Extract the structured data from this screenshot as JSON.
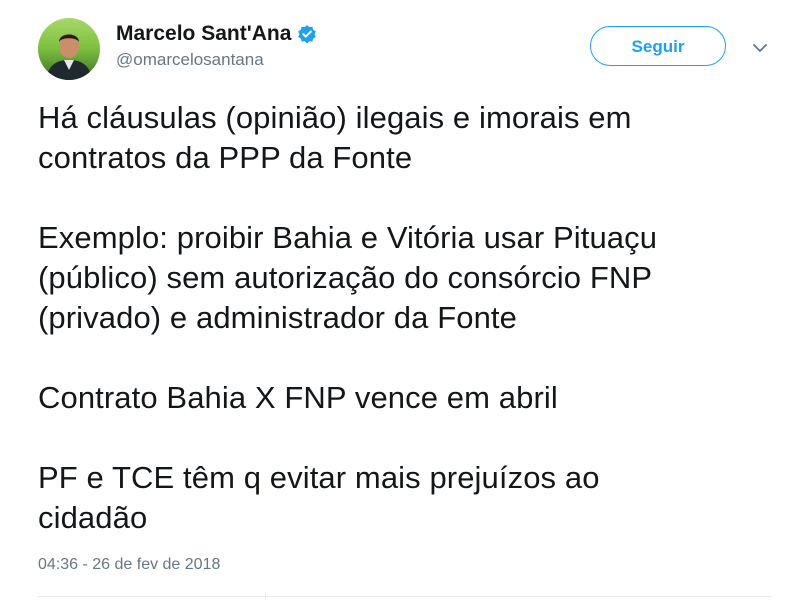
{
  "author": {
    "display_name": "Marcelo Sant'Ana",
    "handle": "@omarcelosantana",
    "verified": true
  },
  "follow_button": {
    "label": "Seguir"
  },
  "tweet": {
    "paragraphs": [
      [
        "Há cláusulas (opinião) ilegais e imorais em",
        "contratos da PPP da Fonte"
      ],
      [
        "Exemplo: proibir Bahia e Vitória usar Pituaçu",
        "(público) sem autorização do consórcio FNP",
        "(privado) e administrador da Fonte"
      ],
      [
        "Contrato Bahia X FNP vence em abril"
      ],
      [
        "PF e TCE têm q evitar mais prejuízos ao",
        "cidadão"
      ]
    ],
    "timestamp": "04:36 - 26 de fev de 2018"
  },
  "icons": {
    "verified": "verified-badge-icon",
    "more": "chevron-down-icon",
    "avatar": "profile-avatar"
  },
  "colors": {
    "accent": "#1da1f2",
    "text": "#14171a",
    "secondary": "#657786",
    "divider": "#e6ecf0"
  }
}
